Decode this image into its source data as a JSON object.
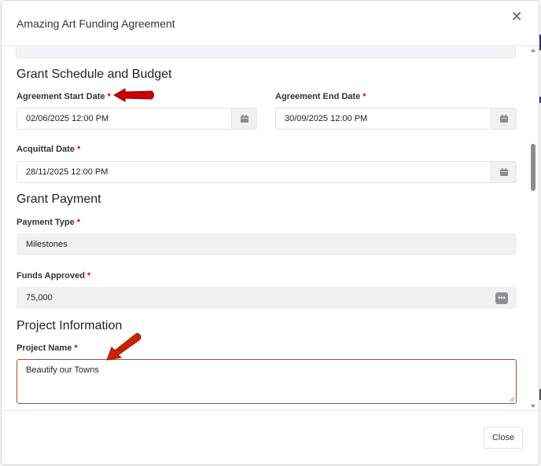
{
  "modal": {
    "title": "Amazing Art Funding Agreement",
    "close_icon": "close-icon"
  },
  "sections": {
    "schedule_title": "Grant Schedule and Budget",
    "payment_title": "Grant Payment",
    "project_title": "Project Information"
  },
  "fields": {
    "start_date": {
      "label": "Agreement Start Date",
      "value": "02/06/2025 12:00 PM",
      "required": "*"
    },
    "end_date": {
      "label": "Agreement End Date",
      "value": "30/09/2025 12:00 PM",
      "required": "*"
    },
    "acquittal_date": {
      "label": "Acquittal Date",
      "value": "28/11/2025 12:00 PM",
      "required": "*"
    },
    "payment_type": {
      "label": "Payment Type",
      "value": "Milestones",
      "required": "*"
    },
    "funds_approved": {
      "label": "Funds Approved",
      "value": "75,000",
      "required": "*"
    },
    "project_name": {
      "label": "Project Name",
      "value": "Beautify our Towns",
      "required": "*"
    }
  },
  "footer": {
    "close_label": "Close"
  },
  "colors": {
    "required": "#d0021b",
    "annotation_arrow": "#cc0000",
    "textarea_border": "#b34a2c"
  },
  "icons": [
    "close-icon",
    "calendar-icon",
    "more-icon",
    "red-arrow-annotation"
  ]
}
